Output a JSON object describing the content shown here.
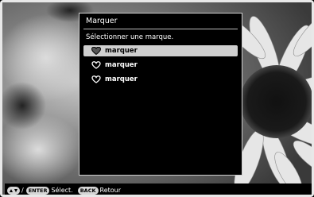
{
  "dialog": {
    "title": "Marquer",
    "prompt": "Sélectionner une marque.",
    "options": [
      {
        "label": "marquer",
        "icon": "heart-filled-icon",
        "selected": true
      },
      {
        "label": "marquer",
        "icon": "heart-outline-icon",
        "selected": false
      },
      {
        "label": "marquer",
        "icon": "heart-outline-icon",
        "selected": false
      }
    ]
  },
  "statusbar": {
    "updown_key_icon": "up-down-arrows-icon",
    "slash": "/",
    "enter_key": "ENTER",
    "select_label": "Sélect.",
    "back_key": "BACK",
    "back_label": "Retour"
  },
  "colors": {
    "highlight": "#cfcfcf",
    "dialog_bg": "#000000",
    "frame_border": "#e8e8e8"
  }
}
